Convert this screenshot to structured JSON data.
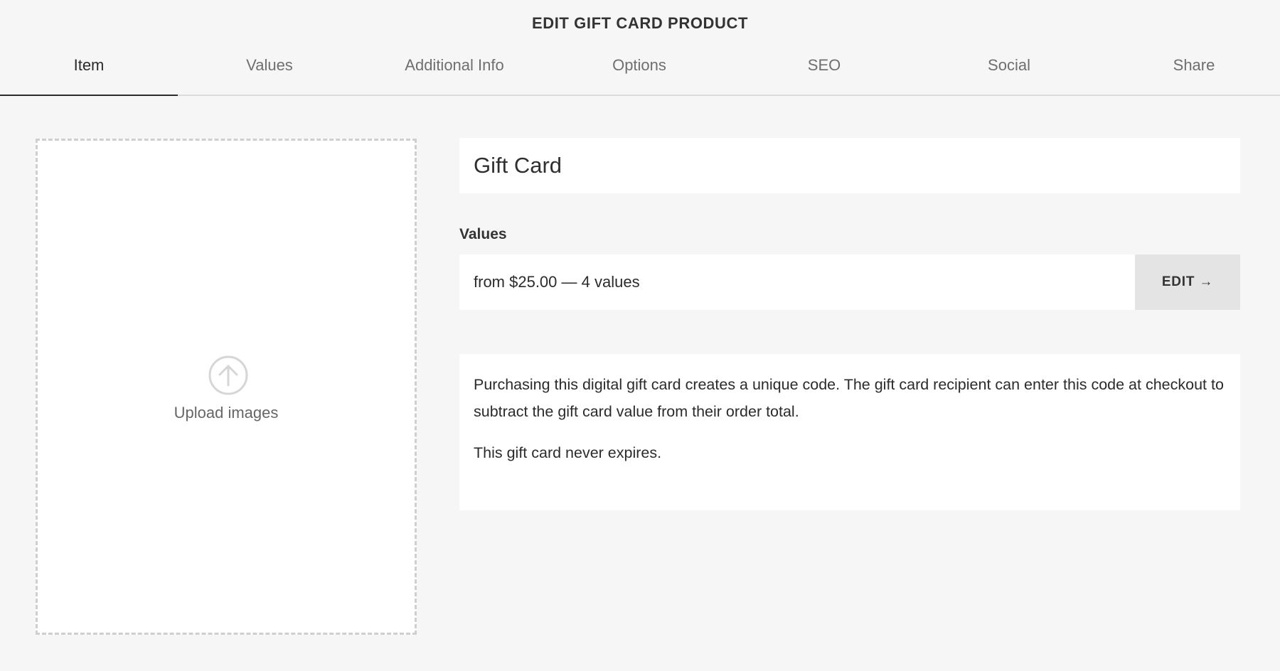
{
  "header": {
    "title": "EDIT GIFT CARD PRODUCT"
  },
  "tabs": [
    {
      "label": "Item",
      "active": true
    },
    {
      "label": "Values",
      "active": false
    },
    {
      "label": "Additional Info",
      "active": false
    },
    {
      "label": "Options",
      "active": false
    },
    {
      "label": "SEO",
      "active": false
    },
    {
      "label": "Social",
      "active": false
    },
    {
      "label": "Share",
      "active": false
    }
  ],
  "upload": {
    "label": "Upload images",
    "icon": "upload-arrow-icon"
  },
  "product": {
    "name": "Gift Card"
  },
  "values": {
    "heading": "Values",
    "summary": "from $25.00 — 4 values",
    "edit_label": "EDIT →"
  },
  "description": {
    "paragraphs": [
      "Purchasing this digital gift card creates a unique code. The gift card recipient can enter this code at checkout to subtract the gift card value from their order total.",
      "This gift card never expires."
    ]
  },
  "colors": {
    "background": "#f6f6f6",
    "panel": "#ffffff",
    "edit_button": "#e4e4e4",
    "text": "#2b2b2b",
    "muted": "#6f6f6f"
  }
}
